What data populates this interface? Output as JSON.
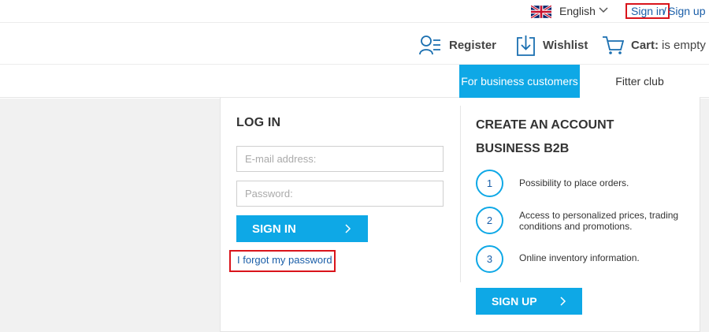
{
  "topbar": {
    "flag_icon": "uk-flag-icon",
    "language": "English",
    "sign_in": "Sign in",
    "separator": "/",
    "sign_up": "Sign up"
  },
  "header": {
    "register": "Register",
    "wishlist": "Wishlist",
    "cart_label": "Cart:",
    "cart_status": "is empty"
  },
  "nav": {
    "business_tab": "For business customers",
    "fitter_tab": "Fitter club"
  },
  "login": {
    "title": "LOG IN",
    "email_placeholder": "E-mail address:",
    "password_placeholder": "Password:",
    "sign_in_button": "SIGN IN",
    "forgot_link": "I forgot my password"
  },
  "create_account": {
    "title": "CREATE AN ACCOUNT BUSINESS B2B",
    "benefits": [
      {
        "number": "1",
        "text": "Possibility to place orders."
      },
      {
        "number": "2",
        "text": "Access to personalized prices, trading conditions and promotions."
      },
      {
        "number": "3",
        "text": "Online inventory information."
      }
    ],
    "sign_up_button": "SIGN UP"
  },
  "colors": {
    "accent": "#0ea8e6",
    "link": "#1a5ea8",
    "highlight_border": "#d9141b"
  }
}
